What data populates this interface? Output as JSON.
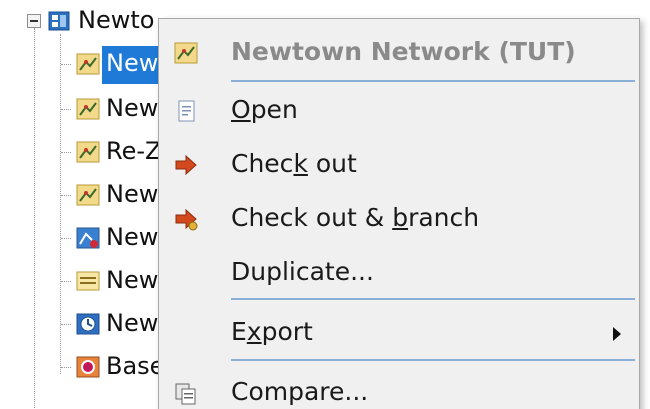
{
  "tree": {
    "root_label": "Newto",
    "children": [
      {
        "label": "New",
        "icon": "network-icon",
        "selected": true
      },
      {
        "label": "New",
        "icon": "network-icon",
        "selected": false
      },
      {
        "label": "Re-Z",
        "icon": "network-icon",
        "selected": false
      },
      {
        "label": "New",
        "icon": "network-icon",
        "selected": false
      },
      {
        "label": "New",
        "icon": "scenario-icon",
        "selected": false
      },
      {
        "label": "New",
        "icon": "list-icon",
        "selected": false
      },
      {
        "label": "New",
        "icon": "timetable-icon",
        "selected": false
      },
      {
        "label": "Base",
        "icon": "base-icon",
        "selected": false
      }
    ]
  },
  "menu": {
    "header": "Newtown Network (TUT)",
    "items": [
      {
        "pre": "",
        "mnemonic": "O",
        "post": "pen",
        "icon": "open-document-icon"
      },
      {
        "pre": "Chec",
        "mnemonic": "k",
        "post": " out",
        "icon": "check-out-arrow-icon"
      },
      {
        "pre": "Check out & ",
        "mnemonic": "b",
        "post": "ranch",
        "icon": "check-out-branch-icon"
      },
      {
        "pre": "Duplicate...",
        "mnemonic": "",
        "post": "",
        "icon": ""
      },
      {
        "pre": "E",
        "mnemonic": "x",
        "post": "port",
        "icon": "",
        "submenu": true
      },
      {
        "pre": "Compare...",
        "mnemonic": "",
        "post": "",
        "icon": "compare-icon"
      }
    ]
  },
  "colors": {
    "selection": "#1e7ad6",
    "menu_bg": "#f0f0f0",
    "separator": "#8ab0d8",
    "header_text": "#8a8a8a"
  }
}
